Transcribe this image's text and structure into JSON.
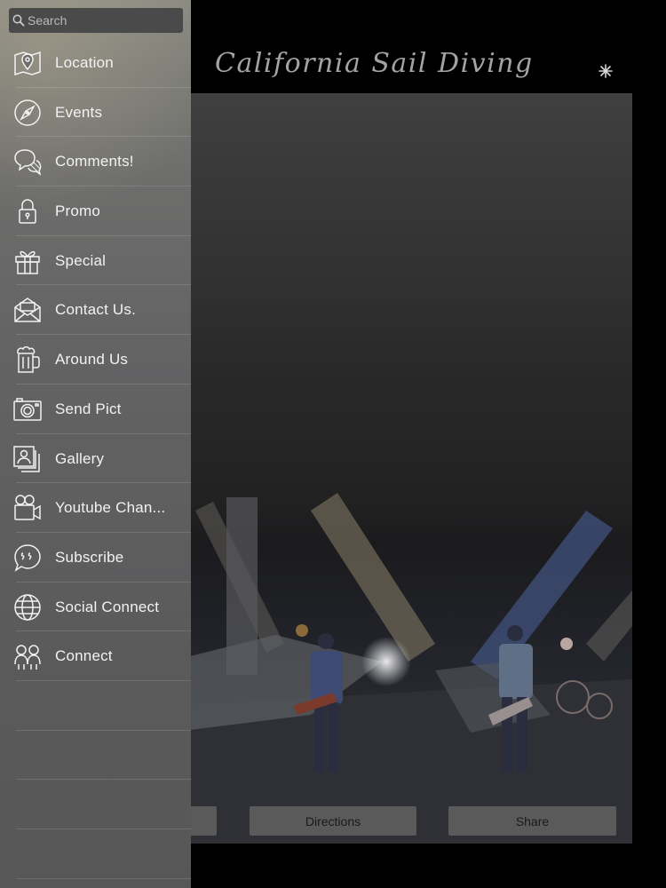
{
  "search": {
    "placeholder": "Search"
  },
  "header": {
    "title": "California Sail Diving"
  },
  "menu": {
    "items": [
      {
        "label": "Location",
        "icon": "map-pin-icon"
      },
      {
        "label": "Events",
        "icon": "compass-icon"
      },
      {
        "label": "Comments!",
        "icon": "chat-bubbles-icon"
      },
      {
        "label": "Promo",
        "icon": "lock-icon"
      },
      {
        "label": "Special",
        "icon": "gift-icon"
      },
      {
        "label": "Contact Us.",
        "icon": "envelope-icon"
      },
      {
        "label": "Around Us",
        "icon": "beer-mug-icon"
      },
      {
        "label": "Send Pict",
        "icon": "camera-icon"
      },
      {
        "label": "Gallery",
        "icon": "photos-icon"
      },
      {
        "label": "Youtube Chan...",
        "icon": "video-camera-icon"
      },
      {
        "label": "Subscribe",
        "icon": "quote-bubble-icon"
      },
      {
        "label": "Social Connect",
        "icon": "globe-icon"
      },
      {
        "label": "Connect",
        "icon": "people-icon"
      }
    ]
  },
  "actions": {
    "directions": "Directions",
    "share": "Share"
  },
  "colors": {
    "drawer_bg": "#636364",
    "page_bg": "#000000",
    "button_bg": "#5a5a5a",
    "title_color": "#a3a3a3"
  }
}
